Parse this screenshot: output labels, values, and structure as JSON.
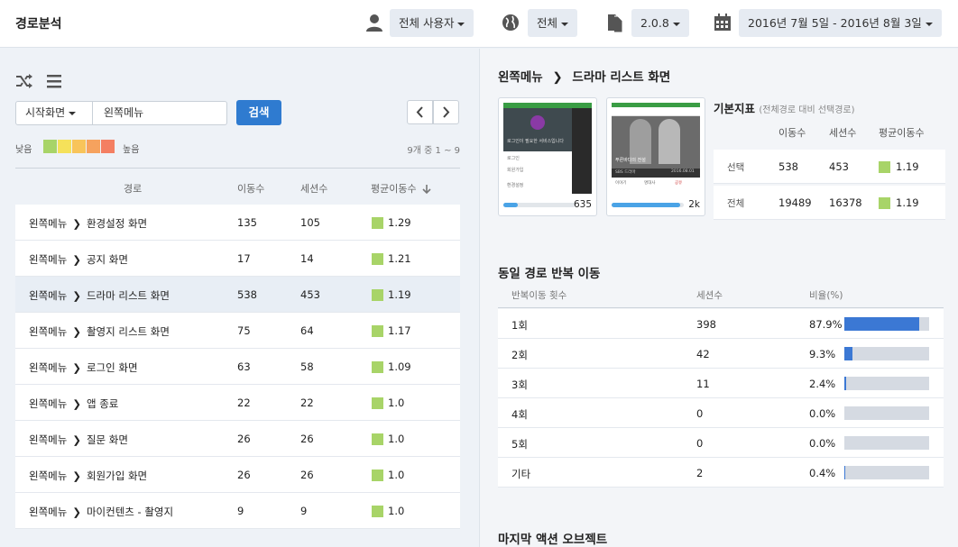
{
  "app": {
    "title": "경로분석"
  },
  "topbar": {
    "user_filter": "전체 사용자",
    "region_filter": "전체",
    "version_filter": "2.0.8",
    "date_range": "2016년 7월 5일 - 2016년 8월 3일"
  },
  "search": {
    "start_select": "시작화면",
    "query_value": "왼쪽메뉴",
    "search_label": "검색"
  },
  "legend": {
    "low": "낮음",
    "high": "높음",
    "colors": [
      "#a8d468",
      "#f5e15a",
      "#f8c45a",
      "#f6a25e",
      "#f47f62"
    ],
    "count_text": "9개 중 1 ~ 9"
  },
  "path_table": {
    "headers": {
      "path": "경로",
      "moves": "이동수",
      "sessions": "세션수",
      "avg": "평균이동수"
    },
    "rows": [
      {
        "from": "왼쪽메뉴",
        "to": "환경설정 화면",
        "moves": "135",
        "sessions": "105",
        "avg": "1.29"
      },
      {
        "from": "왼쪽메뉴",
        "to": "공지 화면",
        "moves": "17",
        "sessions": "14",
        "avg": "1.21"
      },
      {
        "from": "왼쪽메뉴",
        "to": "드라마 리스트 화면",
        "moves": "538",
        "sessions": "453",
        "avg": "1.19"
      },
      {
        "from": "왼쪽메뉴",
        "to": "촬영지 리스트 화면",
        "moves": "75",
        "sessions": "64",
        "avg": "1.17"
      },
      {
        "from": "왼쪽메뉴",
        "to": "로그인 화면",
        "moves": "63",
        "sessions": "58",
        "avg": "1.09"
      },
      {
        "from": "왼쪽메뉴",
        "to": "앱 종료",
        "moves": "22",
        "sessions": "22",
        "avg": "1.0"
      },
      {
        "from": "왼쪽메뉴",
        "to": "질문 화면",
        "moves": "26",
        "sessions": "26",
        "avg": "1.0"
      },
      {
        "from": "왼쪽메뉴",
        "to": "회원가입 화면",
        "moves": "26",
        "sessions": "26",
        "avg": "1.0"
      },
      {
        "from": "왼쪽메뉴",
        "to": "마이컨텐츠 - 촬영지",
        "moves": "9",
        "sessions": "9",
        "avg": "1.0"
      }
    ]
  },
  "detail": {
    "from": "왼쪽메뉴",
    "to": "드라마 리스트 화면",
    "thumb_from": {
      "count": "635",
      "progress": 0.2,
      "caption": "로그인이 필요한 서비스입니다",
      "menu_1": "로그인",
      "menu_2": "회원가입",
      "menu_3": "환경설정"
    },
    "thumb_to": {
      "count": "2k",
      "progress": 0.95,
      "caption": "푸른바다의 전설",
      "sub": "SBS 드라마",
      "date": "2016.08.01",
      "footer_1": "이야기",
      "footer_2": "명대사",
      "footer_3": "공유"
    }
  },
  "kpi": {
    "title": "기본지표",
    "subtitle": "(전체경로 대비 선택경로)",
    "headers": {
      "moves": "이동수",
      "sessions": "세션수",
      "avg": "평균이동수"
    },
    "rows": [
      {
        "label": "선택",
        "moves": "538",
        "sessions": "453",
        "avg": "1.19"
      },
      {
        "label": "전체",
        "moves": "19489",
        "sessions": "16378",
        "avg": "1.19"
      }
    ]
  },
  "repeat": {
    "title": "동일 경로 반복 이동",
    "headers": {
      "count": "반복이동 횟수",
      "sessions": "세션수",
      "ratio": "비율(%)"
    },
    "rows": [
      {
        "label": "1회",
        "sessions": "398",
        "ratio": "87.9%",
        "fraction": 0.879
      },
      {
        "label": "2회",
        "sessions": "42",
        "ratio": "9.3%",
        "fraction": 0.093
      },
      {
        "label": "3회",
        "sessions": "11",
        "ratio": "2.4%",
        "fraction": 0.024
      },
      {
        "label": "4회",
        "sessions": "0",
        "ratio": "0.0%",
        "fraction": 0
      },
      {
        "label": "5회",
        "sessions": "0",
        "ratio": "0.0%",
        "fraction": 0
      },
      {
        "label": "기타",
        "sessions": "2",
        "ratio": "0.4%",
        "fraction": 0.004
      }
    ]
  },
  "last_action": {
    "title": "마지막 액션 오브젝트"
  },
  "colors": {
    "accent": "#2f7bd0",
    "bar": "#3b78d4",
    "quality_low": "#a8d468"
  }
}
